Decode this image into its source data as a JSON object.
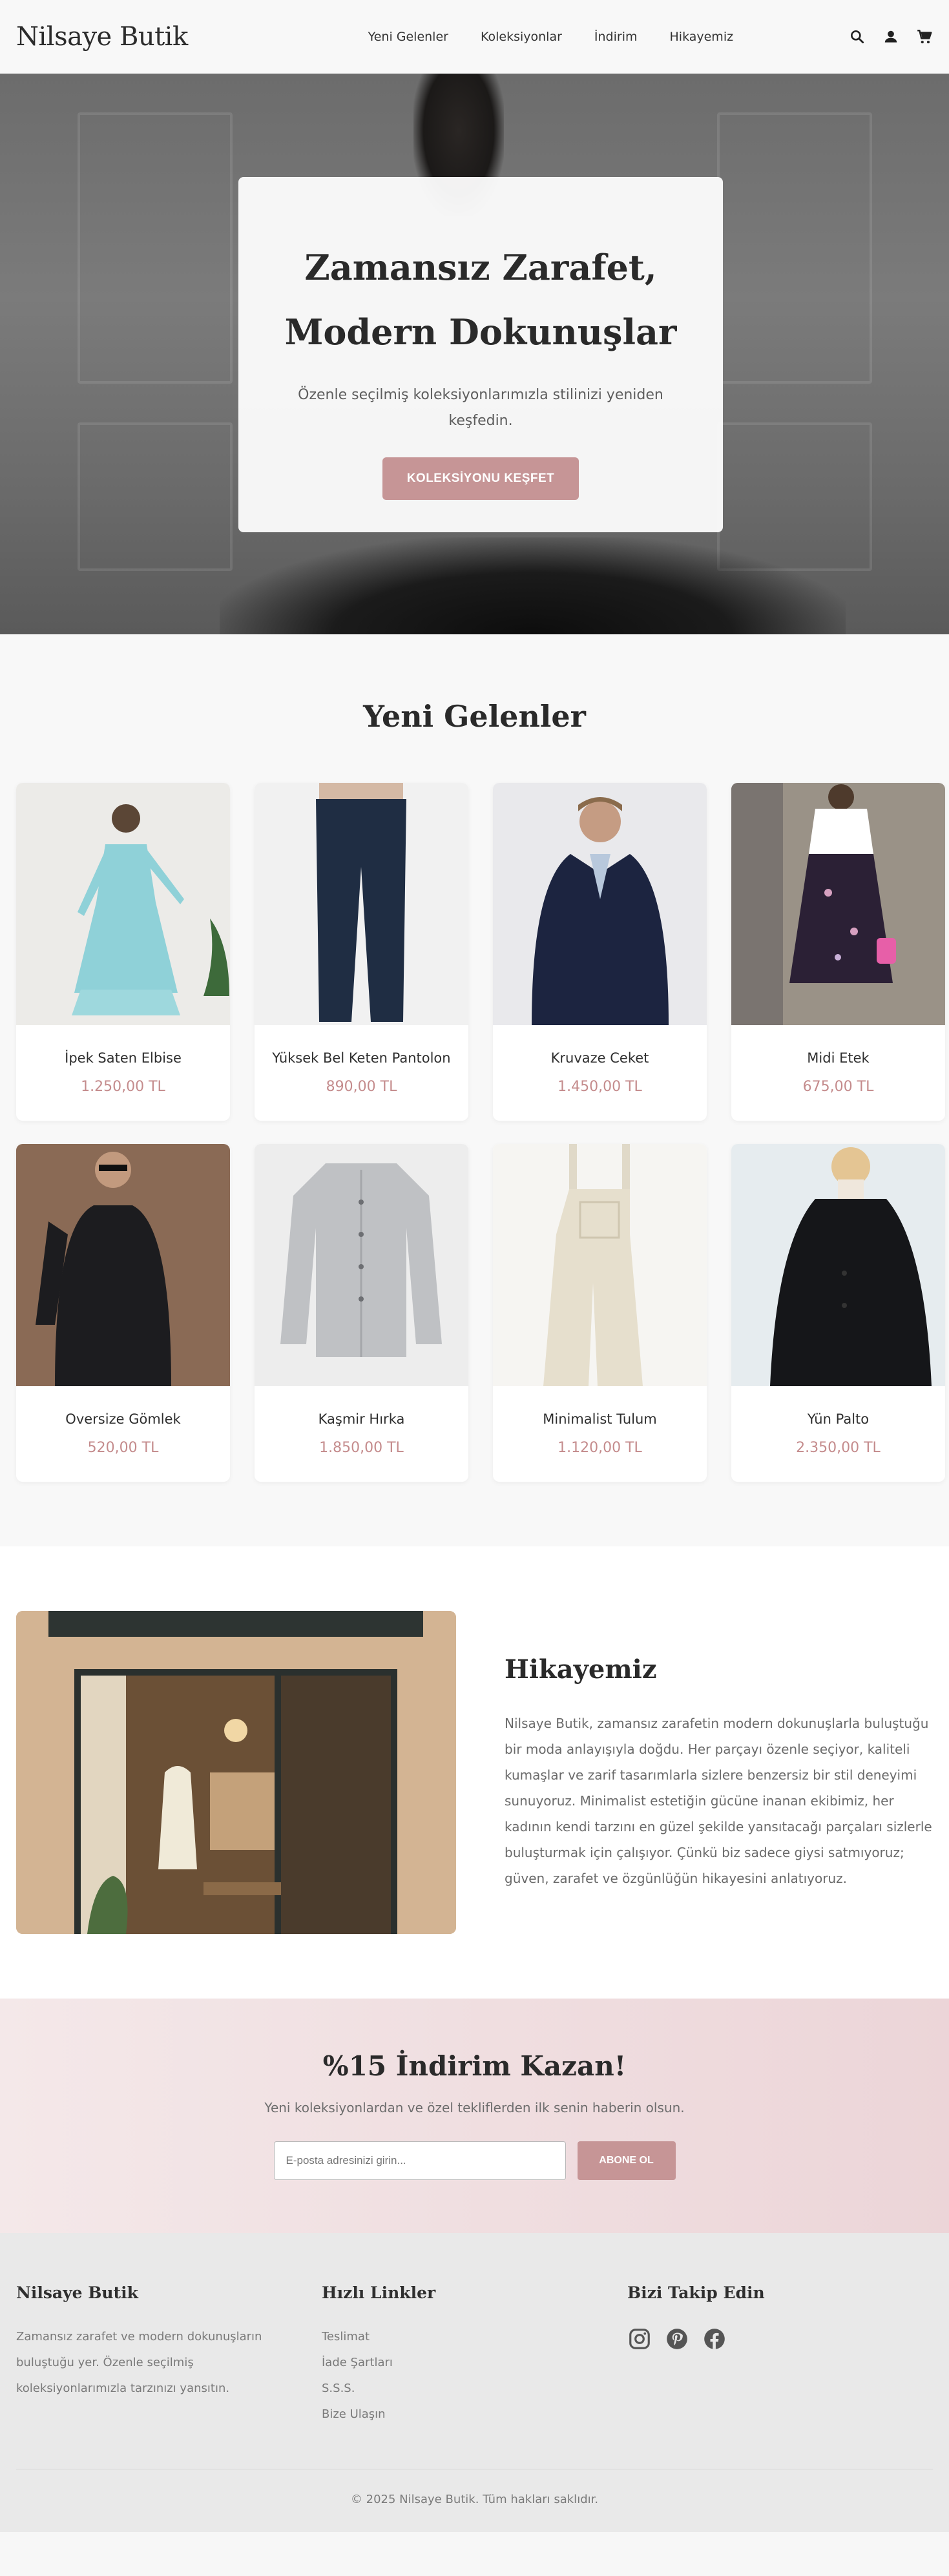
{
  "header": {
    "logo": "Nilsaye Butik",
    "nav": [
      "Yeni Gelenler",
      "Koleksiyonlar",
      "İndirim",
      "Hikayemiz"
    ],
    "icons": [
      "search-icon",
      "user-icon",
      "cart-icon"
    ]
  },
  "hero": {
    "title_line1": "Zamansız Zarafet,",
    "title_line2": "Modern Dokunuşlar",
    "subtitle": "Özenle seçilmiş koleksiyonlarımızla stilinizi yeniden keşfedin.",
    "button": "KOLEKSİYONU KEŞFET"
  },
  "products": {
    "title": "Yeni Gelenler",
    "items": [
      {
        "name": "İpek Saten Elbise",
        "price": "1.250,00 TL"
      },
      {
        "name": "Yüksek Bel Keten Pantolon",
        "price": "890,00 TL"
      },
      {
        "name": "Kruvaze Ceket",
        "price": "1.450,00 TL"
      },
      {
        "name": "Midi Etek",
        "price": "675,00 TL"
      },
      {
        "name": "Oversize Gömlek",
        "price": "520,00 TL"
      },
      {
        "name": "Kaşmir Hırka",
        "price": "1.850,00 TL"
      },
      {
        "name": "Minimalist Tulum",
        "price": "1.120,00 TL"
      },
      {
        "name": "Yün Palto",
        "price": "2.350,00 TL"
      }
    ]
  },
  "story": {
    "title": "Hikayemiz",
    "text": "Nilsaye Butik, zamansız zarafetin modern dokunuşlarla buluştuğu bir moda anlayışıyla doğdu. Her parçayı özenle seçiyor, kaliteli kumaşlar ve zarif tasarımlarla sizlere benzersiz bir stil deneyimi sunuyoruz. Minimalist estetiğin gücüne inanan ekibimiz, her kadının kendi tarzını en güzel şekilde yansıtacağı parçaları sizlerle buluşturmak için çalışıyor. Çünkü biz sadece giysi satmıyoruz; güven, zarafet ve özgünlüğün hikayesini anlatıyoruz."
  },
  "newsletter": {
    "title": "%15 İndirim Kazan!",
    "subtitle": "Yeni koleksiyonlardan ve özel tekliflerden ilk senin haberin olsun.",
    "placeholder": "E-posta adresinizi girin...",
    "button": "ABONE OL"
  },
  "footer": {
    "brand_title": "Nilsaye Butik",
    "brand_text": "Zamansız zarafet ve modern dokunuşların buluştuğu yer. Özenle seçilmiş koleksiyonlarımızla tarzınızı yansıtın.",
    "links_title": "Hızlı Linkler",
    "links": [
      "Teslimat",
      "İade Şartları",
      "S.S.S.",
      "Bize Ulaşın"
    ],
    "social_title": "Bizi Takip Edin",
    "socials": [
      "instagram-icon",
      "pinterest-icon",
      "facebook-icon"
    ],
    "copyright": "© 2025 Nilsaye Butik. Tüm hakları saklıdır."
  },
  "colors": {
    "accent": "#c69596",
    "price": "#c48b8c",
    "newsletter_bg": "#ecd5d8"
  }
}
